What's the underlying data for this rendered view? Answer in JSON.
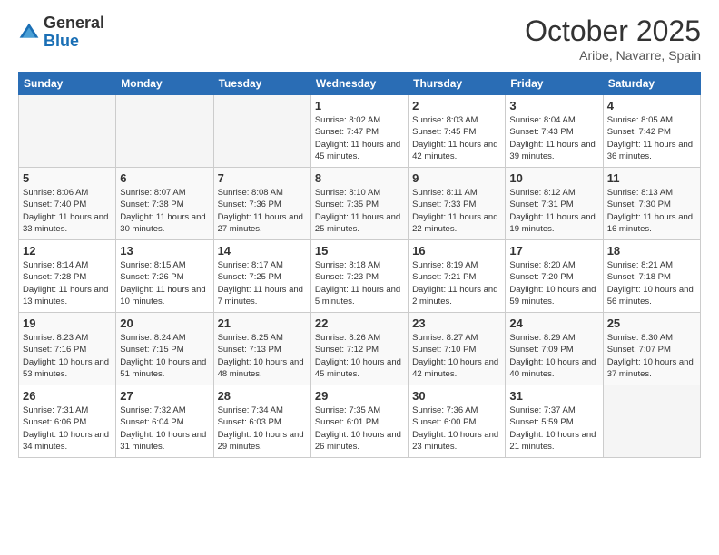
{
  "header": {
    "logo": {
      "general": "General",
      "blue": "Blue"
    },
    "title": "October 2025",
    "location": "Aribe, Navarre, Spain"
  },
  "days_of_week": [
    "Sunday",
    "Monday",
    "Tuesday",
    "Wednesday",
    "Thursday",
    "Friday",
    "Saturday"
  ],
  "weeks": [
    [
      {
        "day": "",
        "info": ""
      },
      {
        "day": "",
        "info": ""
      },
      {
        "day": "",
        "info": ""
      },
      {
        "day": "1",
        "info": "Sunrise: 8:02 AM\nSunset: 7:47 PM\nDaylight: 11 hours\nand 45 minutes."
      },
      {
        "day": "2",
        "info": "Sunrise: 8:03 AM\nSunset: 7:45 PM\nDaylight: 11 hours\nand 42 minutes."
      },
      {
        "day": "3",
        "info": "Sunrise: 8:04 AM\nSunset: 7:43 PM\nDaylight: 11 hours\nand 39 minutes."
      },
      {
        "day": "4",
        "info": "Sunrise: 8:05 AM\nSunset: 7:42 PM\nDaylight: 11 hours\nand 36 minutes."
      }
    ],
    [
      {
        "day": "5",
        "info": "Sunrise: 8:06 AM\nSunset: 7:40 PM\nDaylight: 11 hours\nand 33 minutes."
      },
      {
        "day": "6",
        "info": "Sunrise: 8:07 AM\nSunset: 7:38 PM\nDaylight: 11 hours\nand 30 minutes."
      },
      {
        "day": "7",
        "info": "Sunrise: 8:08 AM\nSunset: 7:36 PM\nDaylight: 11 hours\nand 27 minutes."
      },
      {
        "day": "8",
        "info": "Sunrise: 8:10 AM\nSunset: 7:35 PM\nDaylight: 11 hours\nand 25 minutes."
      },
      {
        "day": "9",
        "info": "Sunrise: 8:11 AM\nSunset: 7:33 PM\nDaylight: 11 hours\nand 22 minutes."
      },
      {
        "day": "10",
        "info": "Sunrise: 8:12 AM\nSunset: 7:31 PM\nDaylight: 11 hours\nand 19 minutes."
      },
      {
        "day": "11",
        "info": "Sunrise: 8:13 AM\nSunset: 7:30 PM\nDaylight: 11 hours\nand 16 minutes."
      }
    ],
    [
      {
        "day": "12",
        "info": "Sunrise: 8:14 AM\nSunset: 7:28 PM\nDaylight: 11 hours\nand 13 minutes."
      },
      {
        "day": "13",
        "info": "Sunrise: 8:15 AM\nSunset: 7:26 PM\nDaylight: 11 hours\nand 10 minutes."
      },
      {
        "day": "14",
        "info": "Sunrise: 8:17 AM\nSunset: 7:25 PM\nDaylight: 11 hours\nand 7 minutes."
      },
      {
        "day": "15",
        "info": "Sunrise: 8:18 AM\nSunset: 7:23 PM\nDaylight: 11 hours\nand 5 minutes."
      },
      {
        "day": "16",
        "info": "Sunrise: 8:19 AM\nSunset: 7:21 PM\nDaylight: 11 hours\nand 2 minutes."
      },
      {
        "day": "17",
        "info": "Sunrise: 8:20 AM\nSunset: 7:20 PM\nDaylight: 10 hours\nand 59 minutes."
      },
      {
        "day": "18",
        "info": "Sunrise: 8:21 AM\nSunset: 7:18 PM\nDaylight: 10 hours\nand 56 minutes."
      }
    ],
    [
      {
        "day": "19",
        "info": "Sunrise: 8:23 AM\nSunset: 7:16 PM\nDaylight: 10 hours\nand 53 minutes."
      },
      {
        "day": "20",
        "info": "Sunrise: 8:24 AM\nSunset: 7:15 PM\nDaylight: 10 hours\nand 51 minutes."
      },
      {
        "day": "21",
        "info": "Sunrise: 8:25 AM\nSunset: 7:13 PM\nDaylight: 10 hours\nand 48 minutes."
      },
      {
        "day": "22",
        "info": "Sunrise: 8:26 AM\nSunset: 7:12 PM\nDaylight: 10 hours\nand 45 minutes."
      },
      {
        "day": "23",
        "info": "Sunrise: 8:27 AM\nSunset: 7:10 PM\nDaylight: 10 hours\nand 42 minutes."
      },
      {
        "day": "24",
        "info": "Sunrise: 8:29 AM\nSunset: 7:09 PM\nDaylight: 10 hours\nand 40 minutes."
      },
      {
        "day": "25",
        "info": "Sunrise: 8:30 AM\nSunset: 7:07 PM\nDaylight: 10 hours\nand 37 minutes."
      }
    ],
    [
      {
        "day": "26",
        "info": "Sunrise: 7:31 AM\nSunset: 6:06 PM\nDaylight: 10 hours\nand 34 minutes."
      },
      {
        "day": "27",
        "info": "Sunrise: 7:32 AM\nSunset: 6:04 PM\nDaylight: 10 hours\nand 31 minutes."
      },
      {
        "day": "28",
        "info": "Sunrise: 7:34 AM\nSunset: 6:03 PM\nDaylight: 10 hours\nand 29 minutes."
      },
      {
        "day": "29",
        "info": "Sunrise: 7:35 AM\nSunset: 6:01 PM\nDaylight: 10 hours\nand 26 minutes."
      },
      {
        "day": "30",
        "info": "Sunrise: 7:36 AM\nSunset: 6:00 PM\nDaylight: 10 hours\nand 23 minutes."
      },
      {
        "day": "31",
        "info": "Sunrise: 7:37 AM\nSunset: 5:59 PM\nDaylight: 10 hours\nand 21 minutes."
      },
      {
        "day": "",
        "info": ""
      }
    ]
  ]
}
